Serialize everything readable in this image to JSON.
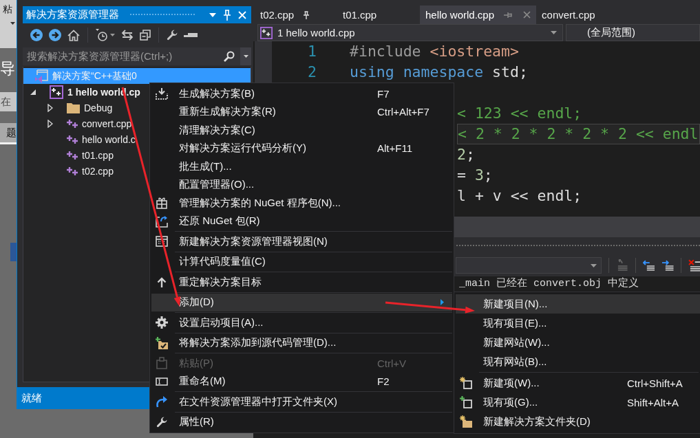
{
  "behind_window": {
    "fragments": [
      "粘",
      "导",
      "在",
      "题"
    ]
  },
  "solution_explorer": {
    "title": "解决方案资源管理器",
    "search": {
      "placeholder": "搜索解决方案资源管理器(Ctrl+;)"
    },
    "tree": [
      {
        "label": "解决方案“C++基础0",
        "kind": "solution",
        "selected": true,
        "bold": false,
        "children": [
          {
            "label": "1 hello world.cp",
            "kind": "project",
            "selected": false,
            "bold": true,
            "expanded": true,
            "children": [
              {
                "label": "Debug",
                "kind": "folder",
                "selected": false,
                "bold": false,
                "expanded": false
              },
              {
                "label": "convert.cpp",
                "kind": "file",
                "selected": false,
                "bold": false,
                "expanded": false
              },
              {
                "label": "hello world.c",
                "kind": "file",
                "selected": false,
                "bold": false
              },
              {
                "label": "t01.cpp",
                "kind": "file",
                "selected": false,
                "bold": false
              },
              {
                "label": "t02.cpp",
                "kind": "file",
                "selected": false,
                "bold": false
              }
            ]
          }
        ]
      }
    ],
    "status": "就绪"
  },
  "editor": {
    "tabs": [
      {
        "label": "t02.cpp",
        "selected": false,
        "pinned": true
      },
      {
        "label": "t01.cpp",
        "selected": false,
        "pinned": false
      },
      {
        "label": "hello world.cpp",
        "selected": true,
        "pinned": false
      },
      {
        "label": "convert.cpp",
        "selected": false,
        "pinned": false
      }
    ],
    "navigation": {
      "file": "1 hello world.cpp",
      "scope": "(全局范围)"
    },
    "lines": [
      {
        "number": "1",
        "current": false,
        "tokens": [
          {
            "text": "#include ",
            "kind": "preprocessor"
          },
          {
            "text": "<iostream>",
            "kind": "string"
          }
        ]
      },
      {
        "number": "2",
        "current": false,
        "tokens": [
          {
            "text": "using namespace ",
            "kind": "keyword"
          },
          {
            "text": "std;",
            "kind": "plain"
          }
        ]
      }
    ],
    "fragments": [
      {
        "current": false,
        "tokens": [
          {
            "text": "< 123 << endl;",
            "kind": "comment"
          }
        ]
      },
      {
        "current": true,
        "tokens": [
          {
            "text": "< 2 * 2 * 2 * 2 * 2 << endl",
            "kind": "comment"
          }
        ]
      },
      {
        "current": false,
        "tokens": [
          {
            "text": "2",
            "kind": "number"
          },
          {
            "text": ";",
            "kind": "plain"
          }
        ]
      },
      {
        "current": false,
        "tokens": [
          {
            "text": "= ",
            "kind": "plain"
          },
          {
            "text": "3",
            "kind": "number"
          },
          {
            "text": ";",
            "kind": "plain"
          }
        ]
      },
      {
        "current": false,
        "tokens": [
          {
            "text": "l + v << endl;",
            "kind": "plain"
          }
        ]
      }
    ]
  },
  "output": {
    "lines": [
      "_main 已经在 convert.obj 中定义"
    ]
  },
  "context_menu": {
    "groups": [
      [
        {
          "label": "生成解决方案(B)",
          "shortcut": "F7",
          "selected": false,
          "disabled": false,
          "submenu": false
        },
        {
          "label": "重新生成解决方案(R)",
          "shortcut": "Ctrl+Alt+F7",
          "selected": false,
          "disabled": false,
          "submenu": false
        },
        {
          "label": "清理解决方案(C)",
          "selected": false,
          "disabled": false,
          "submenu": false
        },
        {
          "label": "对解决方案运行代码分析(Y)",
          "shortcut": "Alt+F11",
          "selected": false,
          "disabled": false,
          "submenu": false
        },
        {
          "label": "批生成(T)...",
          "selected": false,
          "disabled": false,
          "submenu": false
        },
        {
          "label": "配置管理器(O)...",
          "selected": false,
          "disabled": false,
          "submenu": false
        },
        {
          "label": "管理解决方案的 NuGet 程序包(N)...",
          "selected": false,
          "disabled": false,
          "submenu": false
        },
        {
          "label": "还原 NuGet 包(R)",
          "selected": false,
          "disabled": false,
          "submenu": false
        }
      ],
      [
        {
          "label": "新建解决方案资源管理器视图(N)",
          "selected": false,
          "disabled": false,
          "submenu": false
        }
      ],
      [
        {
          "label": "计算代码度量值(C)",
          "selected": false,
          "disabled": false,
          "submenu": false
        }
      ],
      [
        {
          "label": "重定解决方案目标",
          "selected": false,
          "disabled": false,
          "submenu": false
        }
      ],
      [
        {
          "label": "添加(D)",
          "selected": true,
          "disabled": false,
          "submenu": true
        }
      ],
      [
        {
          "label": "设置启动项目(A)...",
          "selected": false,
          "disabled": false,
          "submenu": false
        }
      ],
      [
        {
          "label": "将解决方案添加到源代码管理(D)...",
          "selected": false,
          "disabled": false,
          "submenu": false
        }
      ],
      [
        {
          "label": "粘贴(P)",
          "shortcut": "Ctrl+V",
          "selected": false,
          "disabled": true,
          "submenu": false
        },
        {
          "label": "重命名(M)",
          "shortcut": "F2",
          "selected": false,
          "disabled": false,
          "submenu": false
        }
      ],
      [
        {
          "label": "在文件资源管理器中打开文件夹(X)",
          "selected": false,
          "disabled": false,
          "submenu": false
        }
      ],
      [
        {
          "label": "属性(R)",
          "selected": false,
          "disabled": false,
          "submenu": false
        }
      ]
    ]
  },
  "submenu": {
    "groups": [
      [
        {
          "label": "新建项目(N)...",
          "selected": true,
          "disabled": false,
          "submenu": false
        },
        {
          "label": "现有项目(E)...",
          "selected": false,
          "disabled": false,
          "submenu": false
        },
        {
          "label": "新建网站(W)...",
          "selected": false,
          "disabled": false,
          "submenu": false
        },
        {
          "label": "现有网站(B)...",
          "selected": false,
          "disabled": false,
          "submenu": false
        }
      ],
      [
        {
          "label": "新建项(W)...",
          "shortcut": "Ctrl+Shift+A",
          "selected": false,
          "disabled": false,
          "submenu": false
        },
        {
          "label": "现有项(G)...",
          "shortcut": "Shift+Alt+A",
          "selected": false,
          "disabled": false,
          "submenu": false
        },
        {
          "label": "新建解决方案文件夹(D)",
          "selected": false,
          "disabled": false,
          "submenu": false
        }
      ]
    ]
  }
}
